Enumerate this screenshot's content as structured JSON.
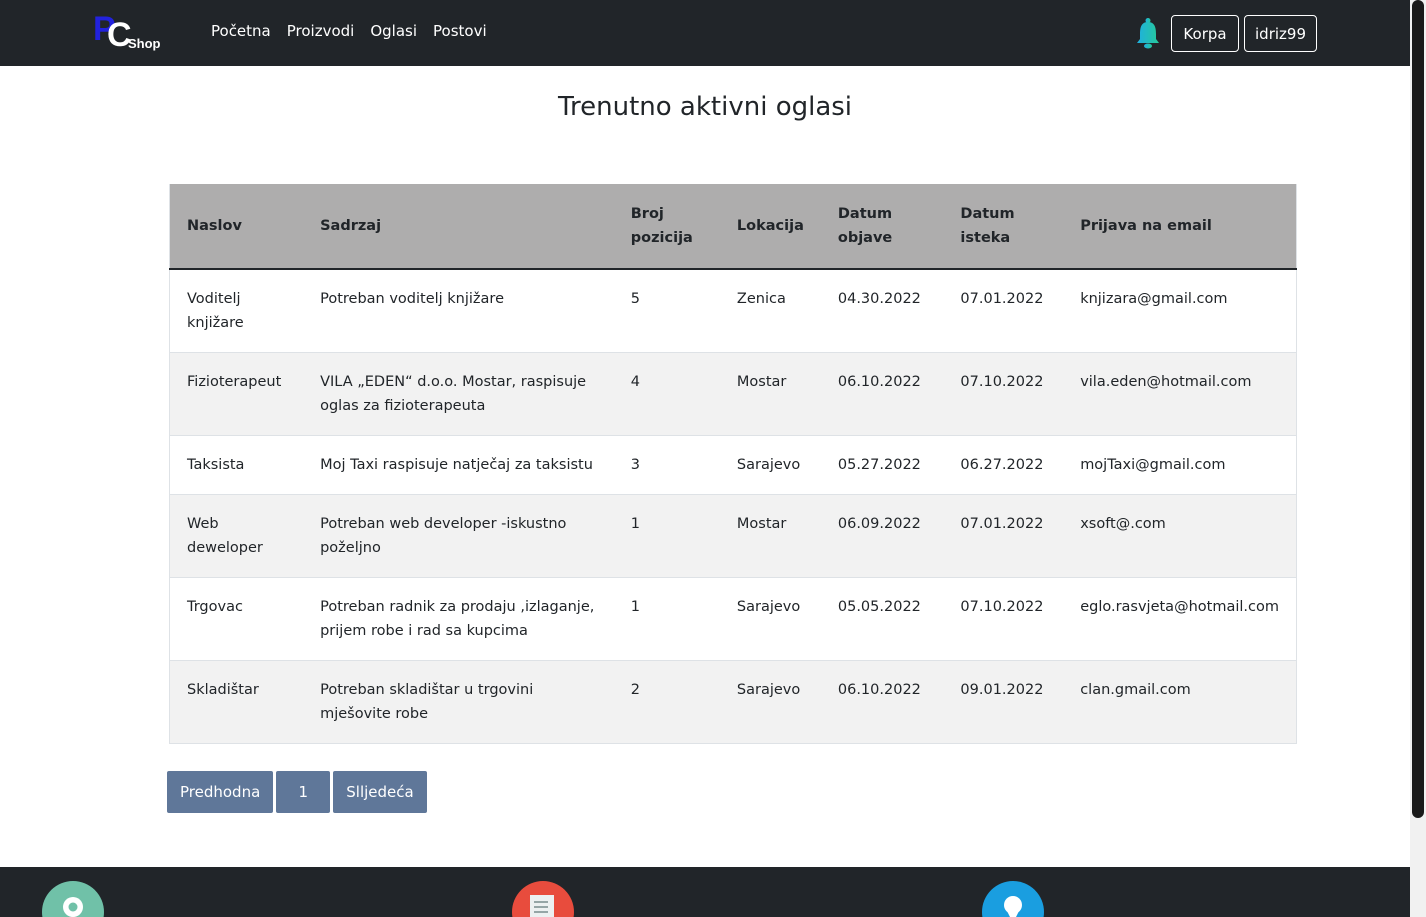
{
  "nav": {
    "logo_p": "P",
    "logo_c": "C",
    "logo_shop": "Shop",
    "links": [
      "Početna",
      "Proizvodi",
      "Oglasi",
      "Postovi"
    ],
    "cart_label": "Korpa",
    "user_label": "idriz99"
  },
  "page": {
    "title": "Trenutno aktivni oglasi"
  },
  "table": {
    "headers": {
      "naslov": "Naslov",
      "sadrzaj": "Sadrzaj",
      "broj_line1": "Broj",
      "broj_line2": "pozicija",
      "lokacija": "Lokacija",
      "objave_line1": "Datum",
      "objave_line2": "objave",
      "isteka_line1": "Datum",
      "isteka_line2": "isteka",
      "email": "Prijava na email"
    },
    "rows": [
      {
        "naslov": "Voditelj knjižare",
        "sadrzaj": "Potreban voditelj knjižare",
        "broj": "5",
        "lokacija": "Zenica",
        "objave": "04.30.2022",
        "isteka": "07.01.2022",
        "email": "knjizara@gmail.com"
      },
      {
        "naslov": "Fizioterapeut",
        "sadrzaj": "VILA „EDEN“ d.o.o. Mostar, raspisuje oglas za fizioterapeuta",
        "broj": "4",
        "lokacija": "Mostar",
        "objave": "06.10.2022",
        "isteka": "07.10.2022",
        "email": "vila.eden@hotmail.com"
      },
      {
        "naslov": "Taksista",
        "sadrzaj": "Moj Taxi raspisuje natječaj za taksistu",
        "broj": "3",
        "lokacija": "Sarajevo",
        "objave": "05.27.2022",
        "isteka": "06.27.2022",
        "email": "mojTaxi@gmail.com"
      },
      {
        "naslov": "Web deweloper",
        "sadrzaj": "Potreban web developer -iskustno poželjno",
        "broj": "1",
        "lokacija": "Mostar",
        "objave": "06.09.2022",
        "isteka": "07.01.2022",
        "email": "xsoft@.com"
      },
      {
        "naslov": "Trgovac",
        "sadrzaj": "Potreban radnik za prodaju ,izlaganje, prijem robe i rad sa kupcima",
        "broj": "1",
        "lokacija": "Sarajevo",
        "objave": "05.05.2022",
        "isteka": "07.10.2022",
        "email": "eglo.rasvjeta@hotmail.com"
      },
      {
        "naslov": "Skladištar",
        "sadrzaj": "Potreban skladištar u trgovini mješovite robe",
        "broj": "2",
        "lokacija": "Sarajevo",
        "objave": "06.10.2022",
        "isteka": "09.01.2022",
        "email": "clan.gmail.com"
      }
    ]
  },
  "pagination": {
    "prev": "Predhodna",
    "current": "1",
    "next": "Slljedeća"
  },
  "footer": {
    "icons": [
      "location-icon",
      "document-icon",
      "pin-icon"
    ]
  },
  "colors": {
    "navbar": "#212529",
    "table_header": "#aeadad",
    "pagination": "#5f7799"
  }
}
